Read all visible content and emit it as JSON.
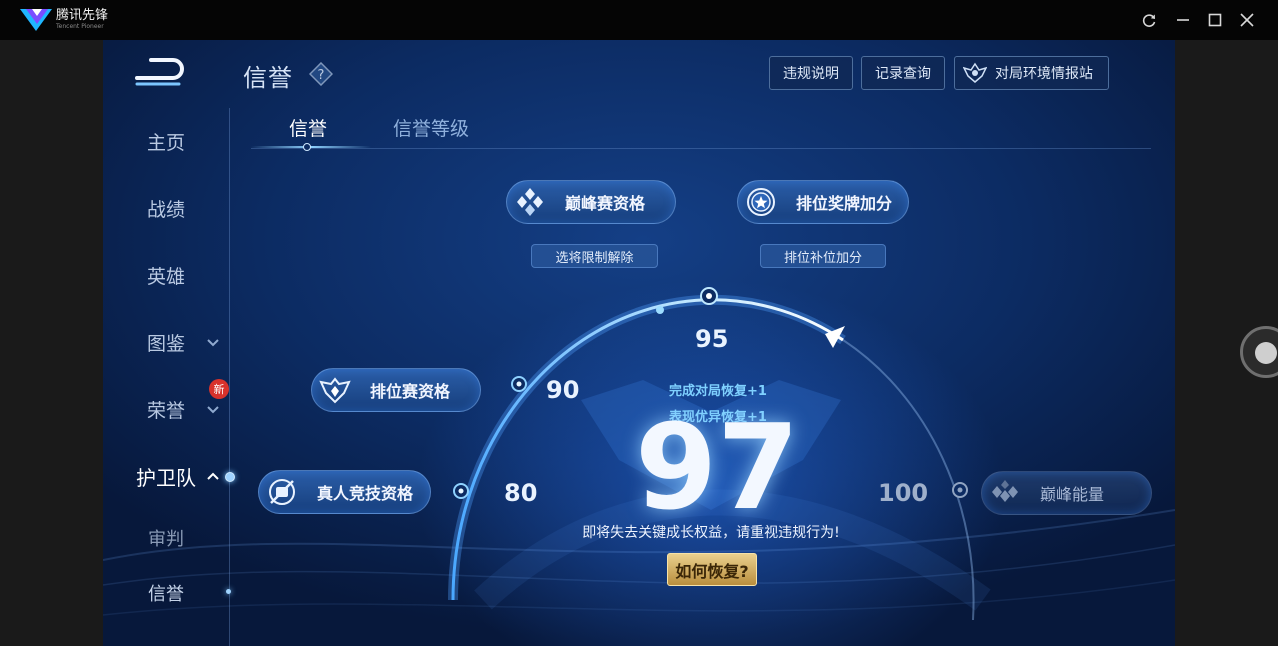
{
  "window": {
    "app_name": "腾讯先锋",
    "app_subtitle": "Tencent Pioneer",
    "controls": [
      "refresh-icon",
      "minimize-icon",
      "maximize-icon",
      "close-icon"
    ]
  },
  "header": {
    "title": "信誉",
    "buttons": {
      "violation_info": "违规说明",
      "record_query": "记录查询",
      "env_report": "对局环境情报站"
    }
  },
  "sidebar": {
    "items": [
      {
        "label": "主页"
      },
      {
        "label": "战绩"
      },
      {
        "label": "英雄"
      },
      {
        "label": "图鉴"
      },
      {
        "label": "荣誉",
        "badge": "新"
      },
      {
        "label": "护卫队",
        "state": "active"
      },
      {
        "label": "审判"
      },
      {
        "label": "信誉"
      }
    ]
  },
  "tabs": [
    {
      "label": "信誉",
      "state": "active"
    },
    {
      "label": "信誉等级"
    }
  ],
  "rewards": {
    "peak_qualification": "巅峰赛资格",
    "peak_sub": "选将限制解除",
    "ranked_medal": "排位奖牌加分",
    "ranked_sub": "排位补位加分",
    "ranked_qualification": "排位赛资格",
    "real_competition": "真人竞技资格",
    "peak_energy": "巅峰能量"
  },
  "score": {
    "value": "97",
    "marks": {
      "m80": "80",
      "m90": "90",
      "m95": "95",
      "m100": "100"
    },
    "recover_1": "完成对局恢复+1",
    "recover_2": "表现优异恢复+1",
    "warning": "即将失去关键成长权益，请重视违规行为!",
    "how_button": "如何恢复?"
  },
  "colors": {
    "accent": "#7fd1ff",
    "gold_button": "#d4b36a",
    "background": "#0c2b62"
  }
}
